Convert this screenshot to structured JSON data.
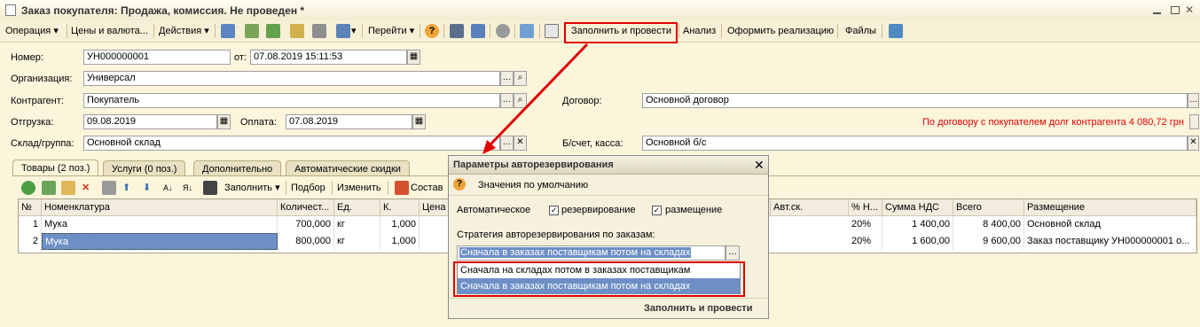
{
  "window": {
    "title": "Заказ покупателя: Продажа, комиссия. Не проведен *",
    "min_icon": "minimize-icon",
    "restore_icon": "restore-icon",
    "close_icon": "close-icon"
  },
  "toolbar": {
    "operation": "Операция",
    "prices": "Цены и валюта...",
    "actions": "Действия",
    "goto": "Перейти",
    "fill_post": "Заполнить и провести",
    "analysis": "Анализ",
    "realization": "Оформить реализацию",
    "files": "Файлы"
  },
  "form": {
    "number_label": "Номер:",
    "number": "УН000000001",
    "from_label": "от:",
    "date": "07.08.2019 15:11:53",
    "org_label": "Организация:",
    "org": "Универсал",
    "contractor_label": "Контрагент:",
    "contractor": "Покупатель",
    "contract_label": "Договор:",
    "contract": "Основной договор",
    "shipment_label": "Отгрузка:",
    "shipment": "09.08.2019",
    "payment_label": "Оплата:",
    "payment": "07.08.2019",
    "debt_text": "По договору с покупателем долг контрагента 4 080,72 грн",
    "warehouse_label": "Склад/группа:",
    "warehouse": "Основной склад",
    "account_label": "Б/счет, касса:",
    "account": "Основной б/с"
  },
  "tabs": [
    "Товары (2 поз.)",
    "Услуги (0 поз.)",
    "Дополнительно",
    "Автоматические скидки"
  ],
  "table_toolbar": {
    "fill": "Заполнить",
    "select": "Подбор",
    "change": "Изменить",
    "composition": "Состав"
  },
  "table": {
    "headers": [
      "№",
      "Номенклатура",
      "Количест...",
      "Ед.",
      "К.",
      "Цена",
      "Авт.ск.",
      "% Н...",
      "Сумма НДС",
      "Всего",
      "Размещение"
    ],
    "rows": [
      [
        "1",
        "Мука",
        "700,000",
        "кг",
        "1,000",
        "",
        "",
        "20%",
        "1 400,00",
        "8 400,00",
        "Основной склад"
      ],
      [
        "2",
        "Мука",
        "800,000",
        "кг",
        "1,000",
        "",
        "",
        "20%",
        "1 600,00",
        "9 600,00",
        "Заказ поставщику УН000000001 о..."
      ]
    ]
  },
  "dialog": {
    "title": "Параметры авторезервирования",
    "defaults": "Значения по умолчанию",
    "auto_label": "Автоматическое",
    "reserve_label": "резервирование",
    "placement_label": "размещение",
    "strategy_label": "Стратегия авторезервирования по заказам:",
    "strategy_value": "Сначала в заказах поставщикам потом на складах",
    "options": [
      "Сначала на складах потом в заказах поставщикам",
      "Сначала в заказах поставщикам потом на складах"
    ],
    "fill_post": "Заполнить и провести"
  },
  "colors": {
    "highlight": "#e00000",
    "selection": "#6d8fc6",
    "debt": "#e00000"
  }
}
